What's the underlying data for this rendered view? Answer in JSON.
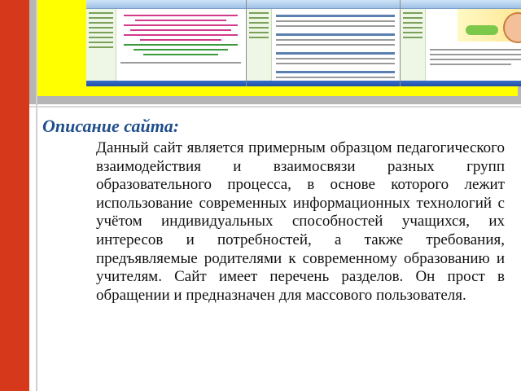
{
  "slide": {
    "heading": "Описание сайта:",
    "body": "Данный сайт является примерным образцом педагогического взаимодействия и взаимосвязи разных групп образовательного процесса, в основе которого лежит использование современных информационных технологий с учётом индивидуальных способностей учащихся, их интересов и потребностей, а также требования, предъявляемые родителями к современному образованию и учителям. Сайт имеет перечень разделов. Он прост в обращении и предназначен для массового пользователя."
  },
  "colors": {
    "accent_red": "#d6381c",
    "frame_yellow": "#ffff00",
    "heading_blue": "#1f4e8c",
    "band_gray": "#b5b5b5"
  },
  "screenshots": [
    {
      "icon": "website-homepage-screenshot"
    },
    {
      "icon": "website-section-screenshot"
    },
    {
      "icon": "website-banner-screenshot"
    }
  ]
}
